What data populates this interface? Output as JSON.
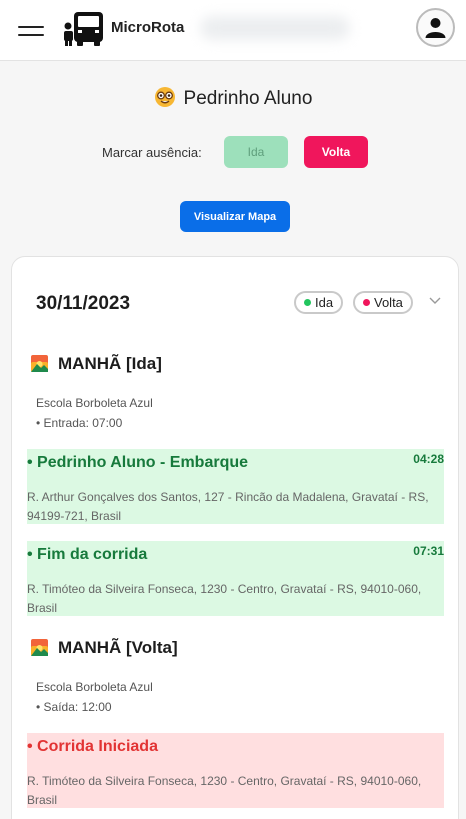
{
  "header": {
    "brand": "MicroRota",
    "menu_icon": "menu-icon",
    "logo_icon": "bus-icon",
    "profile_icon": "user-avatar-icon"
  },
  "student": {
    "name": "Pedrinho Aluno",
    "icon": "nerd-face-emoji"
  },
  "absence": {
    "label": "Marcar ausência:",
    "ida_label": "Ida",
    "volta_label": "Volta"
  },
  "map_button": "Visualizar Mapa",
  "trip": {
    "date": "30/11/2023",
    "chips": [
      {
        "label": "Ida",
        "color": "#22c55e"
      },
      {
        "label": "Volta",
        "color": "#f0165c"
      }
    ],
    "shifts": [
      {
        "title": "MANHÃ [Ida]",
        "school": "Escola Borboleta Azul",
        "time": "• Entrada: 07:00",
        "events": [
          {
            "title": "• Pedrinho Aluno - Embarque",
            "time": "04:28",
            "address": "R. Arthur Gonçalves dos Santos, 127 - Rincão da Madalena, Gravataí - RS, 94199-721, Brasil",
            "status": "success"
          },
          {
            "title": "• Fim da corrida",
            "time": "07:31",
            "address": "R. Timóteo da Silveira Fonseca, 1230 - Centro, Gravataí - RS, 94010-060, Brasil",
            "status": "success"
          }
        ]
      },
      {
        "title": "MANHÃ [Volta]",
        "school": "Escola Borboleta Azul",
        "time": "• Saída: 12:00",
        "events": [
          {
            "title": "• Corrida Iniciada",
            "time": "",
            "address": "R. Timóteo da Silveira Fonseca, 1230 - Centro, Gravataí - RS, 94010-060, Brasil",
            "status": "danger"
          }
        ]
      }
    ]
  },
  "colors": {
    "success_bg": "#dcf9e3",
    "success_text": "#177a3c",
    "danger_bg": "#ffdfe0",
    "danger_text": "#e23434",
    "primary": "#0a6ee8",
    "volta": "#f0165c",
    "ida_disabled": "#9de0bb"
  }
}
